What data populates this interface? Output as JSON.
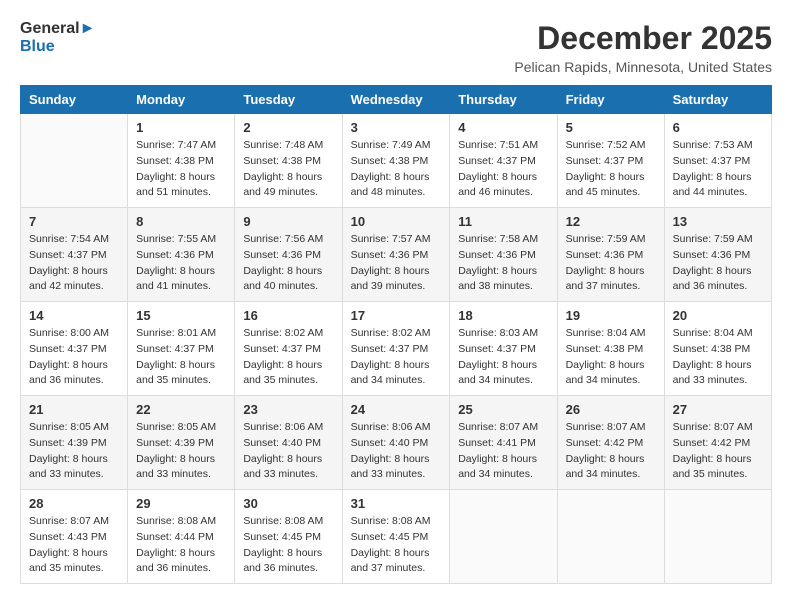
{
  "logo": {
    "general": "General",
    "blue": "Blue"
  },
  "title": "December 2025",
  "subtitle": "Pelican Rapids, Minnesota, United States",
  "weekdays": [
    "Sunday",
    "Monday",
    "Tuesday",
    "Wednesday",
    "Thursday",
    "Friday",
    "Saturday"
  ],
  "weeks": [
    [
      {
        "day": "",
        "sunrise": "",
        "sunset": "",
        "daylight": ""
      },
      {
        "day": "1",
        "sunrise": "Sunrise: 7:47 AM",
        "sunset": "Sunset: 4:38 PM",
        "daylight": "Daylight: 8 hours and 51 minutes."
      },
      {
        "day": "2",
        "sunrise": "Sunrise: 7:48 AM",
        "sunset": "Sunset: 4:38 PM",
        "daylight": "Daylight: 8 hours and 49 minutes."
      },
      {
        "day": "3",
        "sunrise": "Sunrise: 7:49 AM",
        "sunset": "Sunset: 4:38 PM",
        "daylight": "Daylight: 8 hours and 48 minutes."
      },
      {
        "day": "4",
        "sunrise": "Sunrise: 7:51 AM",
        "sunset": "Sunset: 4:37 PM",
        "daylight": "Daylight: 8 hours and 46 minutes."
      },
      {
        "day": "5",
        "sunrise": "Sunrise: 7:52 AM",
        "sunset": "Sunset: 4:37 PM",
        "daylight": "Daylight: 8 hours and 45 minutes."
      },
      {
        "day": "6",
        "sunrise": "Sunrise: 7:53 AM",
        "sunset": "Sunset: 4:37 PM",
        "daylight": "Daylight: 8 hours and 44 minutes."
      }
    ],
    [
      {
        "day": "7",
        "sunrise": "Sunrise: 7:54 AM",
        "sunset": "Sunset: 4:37 PM",
        "daylight": "Daylight: 8 hours and 42 minutes."
      },
      {
        "day": "8",
        "sunrise": "Sunrise: 7:55 AM",
        "sunset": "Sunset: 4:36 PM",
        "daylight": "Daylight: 8 hours and 41 minutes."
      },
      {
        "day": "9",
        "sunrise": "Sunrise: 7:56 AM",
        "sunset": "Sunset: 4:36 PM",
        "daylight": "Daylight: 8 hours and 40 minutes."
      },
      {
        "day": "10",
        "sunrise": "Sunrise: 7:57 AM",
        "sunset": "Sunset: 4:36 PM",
        "daylight": "Daylight: 8 hours and 39 minutes."
      },
      {
        "day": "11",
        "sunrise": "Sunrise: 7:58 AM",
        "sunset": "Sunset: 4:36 PM",
        "daylight": "Daylight: 8 hours and 38 minutes."
      },
      {
        "day": "12",
        "sunrise": "Sunrise: 7:59 AM",
        "sunset": "Sunset: 4:36 PM",
        "daylight": "Daylight: 8 hours and 37 minutes."
      },
      {
        "day": "13",
        "sunrise": "Sunrise: 7:59 AM",
        "sunset": "Sunset: 4:36 PM",
        "daylight": "Daylight: 8 hours and 36 minutes."
      }
    ],
    [
      {
        "day": "14",
        "sunrise": "Sunrise: 8:00 AM",
        "sunset": "Sunset: 4:37 PM",
        "daylight": "Daylight: 8 hours and 36 minutes."
      },
      {
        "day": "15",
        "sunrise": "Sunrise: 8:01 AM",
        "sunset": "Sunset: 4:37 PM",
        "daylight": "Daylight: 8 hours and 35 minutes."
      },
      {
        "day": "16",
        "sunrise": "Sunrise: 8:02 AM",
        "sunset": "Sunset: 4:37 PM",
        "daylight": "Daylight: 8 hours and 35 minutes."
      },
      {
        "day": "17",
        "sunrise": "Sunrise: 8:02 AM",
        "sunset": "Sunset: 4:37 PM",
        "daylight": "Daylight: 8 hours and 34 minutes."
      },
      {
        "day": "18",
        "sunrise": "Sunrise: 8:03 AM",
        "sunset": "Sunset: 4:37 PM",
        "daylight": "Daylight: 8 hours and 34 minutes."
      },
      {
        "day": "19",
        "sunrise": "Sunrise: 8:04 AM",
        "sunset": "Sunset: 4:38 PM",
        "daylight": "Daylight: 8 hours and 34 minutes."
      },
      {
        "day": "20",
        "sunrise": "Sunrise: 8:04 AM",
        "sunset": "Sunset: 4:38 PM",
        "daylight": "Daylight: 8 hours and 33 minutes."
      }
    ],
    [
      {
        "day": "21",
        "sunrise": "Sunrise: 8:05 AM",
        "sunset": "Sunset: 4:39 PM",
        "daylight": "Daylight: 8 hours and 33 minutes."
      },
      {
        "day": "22",
        "sunrise": "Sunrise: 8:05 AM",
        "sunset": "Sunset: 4:39 PM",
        "daylight": "Daylight: 8 hours and 33 minutes."
      },
      {
        "day": "23",
        "sunrise": "Sunrise: 8:06 AM",
        "sunset": "Sunset: 4:40 PM",
        "daylight": "Daylight: 8 hours and 33 minutes."
      },
      {
        "day": "24",
        "sunrise": "Sunrise: 8:06 AM",
        "sunset": "Sunset: 4:40 PM",
        "daylight": "Daylight: 8 hours and 33 minutes."
      },
      {
        "day": "25",
        "sunrise": "Sunrise: 8:07 AM",
        "sunset": "Sunset: 4:41 PM",
        "daylight": "Daylight: 8 hours and 34 minutes."
      },
      {
        "day": "26",
        "sunrise": "Sunrise: 8:07 AM",
        "sunset": "Sunset: 4:42 PM",
        "daylight": "Daylight: 8 hours and 34 minutes."
      },
      {
        "day": "27",
        "sunrise": "Sunrise: 8:07 AM",
        "sunset": "Sunset: 4:42 PM",
        "daylight": "Daylight: 8 hours and 35 minutes."
      }
    ],
    [
      {
        "day": "28",
        "sunrise": "Sunrise: 8:07 AM",
        "sunset": "Sunset: 4:43 PM",
        "daylight": "Daylight: 8 hours and 35 minutes."
      },
      {
        "day": "29",
        "sunrise": "Sunrise: 8:08 AM",
        "sunset": "Sunset: 4:44 PM",
        "daylight": "Daylight: 8 hours and 36 minutes."
      },
      {
        "day": "30",
        "sunrise": "Sunrise: 8:08 AM",
        "sunset": "Sunset: 4:45 PM",
        "daylight": "Daylight: 8 hours and 36 minutes."
      },
      {
        "day": "31",
        "sunrise": "Sunrise: 8:08 AM",
        "sunset": "Sunset: 4:45 PM",
        "daylight": "Daylight: 8 hours and 37 minutes."
      },
      {
        "day": "",
        "sunrise": "",
        "sunset": "",
        "daylight": ""
      },
      {
        "day": "",
        "sunrise": "",
        "sunset": "",
        "daylight": ""
      },
      {
        "day": "",
        "sunrise": "",
        "sunset": "",
        "daylight": ""
      }
    ]
  ]
}
